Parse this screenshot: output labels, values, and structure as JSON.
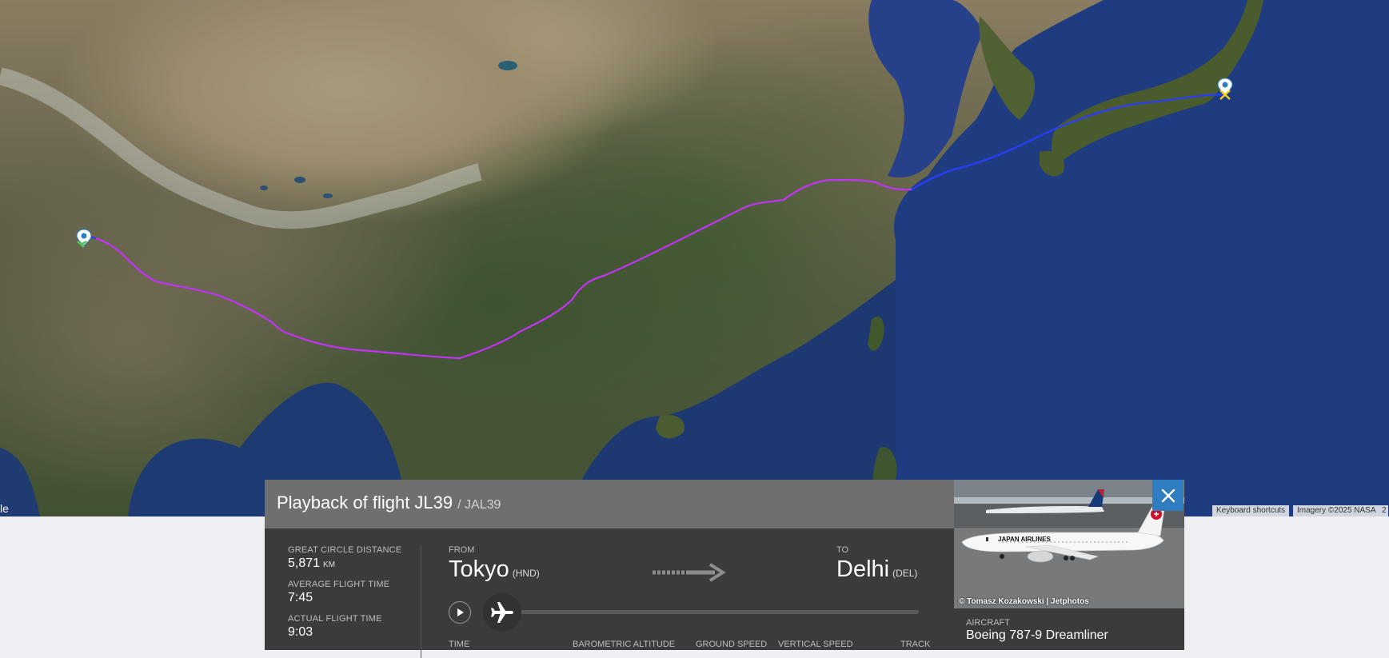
{
  "map": {
    "left_label": "le",
    "attribution": {
      "keyboard_shortcuts": "Keyboard shortcuts",
      "imagery": "Imagery ©2025 NASA",
      "extra": "2"
    },
    "colors": {
      "route_purple": "#c133f5",
      "route_blue": "#1a2dff",
      "marker": "#ffffff"
    }
  },
  "panel": {
    "title": "Playback of flight JL39",
    "callsign": "/ JAL39",
    "stats": {
      "great_circle_label": "GREAT CIRCLE DISTANCE",
      "great_circle_value": "5,871",
      "great_circle_unit": "KM",
      "avg_time_label": "AVERAGE FLIGHT TIME",
      "avg_time_value": "7:45",
      "actual_time_label": "ACTUAL FLIGHT TIME",
      "actual_time_value": "9:03"
    },
    "route": {
      "from_label": "FROM",
      "from_city": "Tokyo",
      "from_iata": "(HND)",
      "to_label": "TO",
      "to_city": "Delhi",
      "to_iata": "(DEL)"
    },
    "playback": {
      "progress": 0
    },
    "columns": {
      "time": "TIME",
      "baro_alt": "BAROMETRIC ALTITUDE",
      "ground_speed": "GROUND SPEED",
      "vertical_speed": "VERTICAL SPEED",
      "track": "TRACK"
    }
  },
  "aircraft": {
    "photo_credit": "© Tomasz Kozakowski | Jetphotos",
    "photo_livery_text": "JAPAN AIRLINES",
    "label": "AIRCRAFT",
    "value": "Boeing 787-9 Dreamliner"
  }
}
